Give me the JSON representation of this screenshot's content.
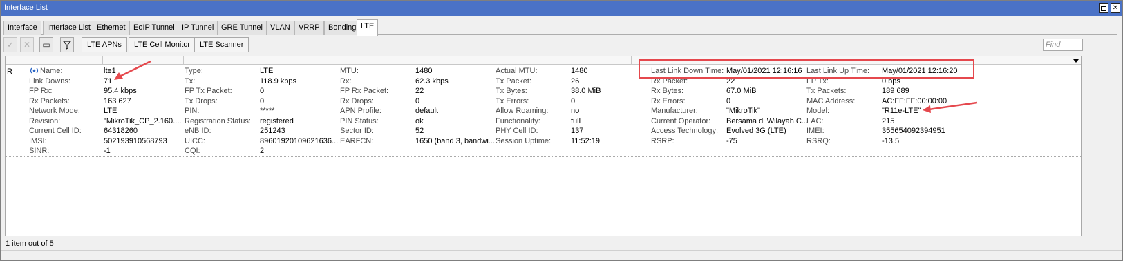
{
  "window": {
    "title": "Interface List",
    "maximize_icon": "maximize-icon",
    "close_icon": "close-icon",
    "close_glyph": "✕"
  },
  "tabs": [
    {
      "label": "Interface"
    },
    {
      "label": "Interface List"
    },
    {
      "label": "Ethernet"
    },
    {
      "label": "EoIP Tunnel"
    },
    {
      "label": "IP Tunnel"
    },
    {
      "label": "GRE Tunnel"
    },
    {
      "label": "VLAN"
    },
    {
      "label": "VRRP"
    },
    {
      "label": "Bonding"
    },
    {
      "label": "LTE"
    }
  ],
  "toolbar": {
    "enable_glyph": "✓",
    "disable_glyph": "✕",
    "comment_glyph": "▭",
    "lte_apns": "LTE APNs",
    "lte_cell_monitor": "LTE Cell Monitor",
    "lte_scanner": "LTE Scanner",
    "find_placeholder": "Find"
  },
  "row": {
    "flag": "R",
    "columns": [
      [
        {
          "label": "Name:",
          "value": "lte1"
        },
        {
          "label": "Link Downs:",
          "value": "71"
        },
        {
          "label": "FP Rx:",
          "value": "95.4 kbps"
        },
        {
          "label": "Rx Packets:",
          "value": "163 627"
        },
        {
          "label": "Network Mode:",
          "value": "LTE"
        },
        {
          "label": "Revision:",
          "value": "\"MikroTik_CP_2.160...."
        },
        {
          "label": "Current Cell ID:",
          "value": "64318260"
        },
        {
          "label": "IMSI:",
          "value": "502193910568793"
        },
        {
          "label": "SINR:",
          "value": "-1"
        }
      ],
      [
        {
          "label": "Type:",
          "value": "LTE"
        },
        {
          "label": "Tx:",
          "value": "118.9 kbps"
        },
        {
          "label": "FP Tx Packet:",
          "value": "0"
        },
        {
          "label": "Tx Drops:",
          "value": "0"
        },
        {
          "label": "PIN:",
          "value": "*****"
        },
        {
          "label": "Registration Status:",
          "value": "registered"
        },
        {
          "label": "eNB ID:",
          "value": "251243"
        },
        {
          "label": "UICC:",
          "value": "89601920109621636..."
        },
        {
          "label": "CQI:",
          "value": "2"
        }
      ],
      [
        {
          "label": "MTU:",
          "value": "1480"
        },
        {
          "label": "Rx:",
          "value": "62.3 kbps"
        },
        {
          "label": "FP Rx Packet:",
          "value": "22"
        },
        {
          "label": "Rx Drops:",
          "value": "0"
        },
        {
          "label": "APN Profile:",
          "value": "default"
        },
        {
          "label": "PIN Status:",
          "value": "ok"
        },
        {
          "label": "Sector ID:",
          "value": "52"
        },
        {
          "label": "EARFCN:",
          "value": "1650 (band 3, bandwi..."
        }
      ],
      [
        {
          "label": "Actual MTU:",
          "value": "1480"
        },
        {
          "label": "Tx Packet:",
          "value": "26"
        },
        {
          "label": "Tx Bytes:",
          "value": "38.0 MiB"
        },
        {
          "label": "Tx Errors:",
          "value": "0"
        },
        {
          "label": "Allow Roaming:",
          "value": "no"
        },
        {
          "label": "Functionality:",
          "value": "full"
        },
        {
          "label": "PHY Cell ID:",
          "value": "137"
        },
        {
          "label": "Session Uptime:",
          "value": "11:52:19"
        }
      ],
      [
        {
          "label": "Last Link Down Time:",
          "value": "May/01/2021 12:16:16"
        },
        {
          "label": "Rx Packet:",
          "value": "22"
        },
        {
          "label": "Rx Bytes:",
          "value": "67.0 MiB"
        },
        {
          "label": "Rx Errors:",
          "value": "0"
        },
        {
          "label": "Manufacturer:",
          "value": "\"MikroTik\""
        },
        {
          "label": "Current Operator:",
          "value": "Bersama di Wilayah C..."
        },
        {
          "label": "Access Technology:",
          "value": "Evolved 3G (LTE)"
        },
        {
          "label": "RSRP:",
          "value": "-75"
        }
      ],
      [
        {
          "label": "Last Link Up Time:",
          "value": "May/01/2021 12:16:20"
        },
        {
          "label": "FP Tx:",
          "value": "0 bps"
        },
        {
          "label": "Tx Packets:",
          "value": "189 689"
        },
        {
          "label": "MAC Address:",
          "value": "AC:FF:FF:00:00:00"
        },
        {
          "label": "Model:",
          "value": "\"R11e-LTE\""
        },
        {
          "label": "LAC:",
          "value": "215"
        },
        {
          "label": "IMEI:",
          "value": "355654092394951"
        },
        {
          "label": "RSRQ:",
          "value": "-13.5"
        }
      ]
    ]
  },
  "status": {
    "text": "1 item out of 5"
  },
  "colors": {
    "titlebar": "#4a72c6",
    "annotation": "#e5484d"
  }
}
